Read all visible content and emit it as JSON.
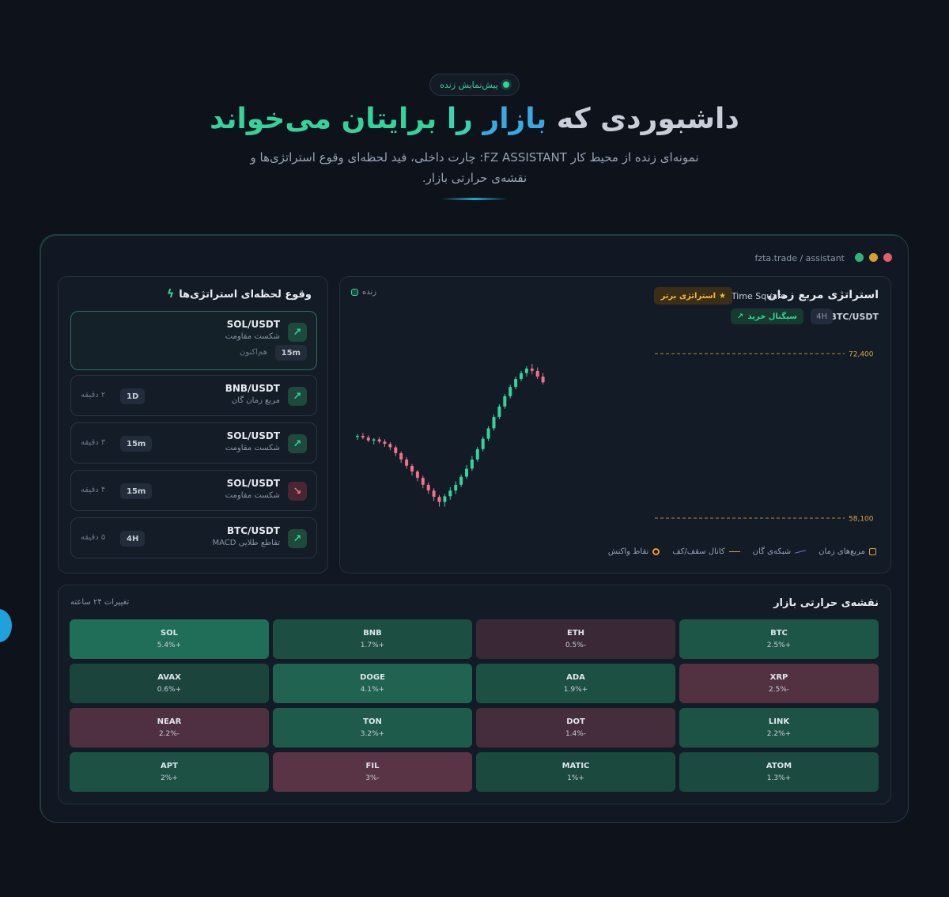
{
  "hero": {
    "badge": "پیش‌نمایش زنده",
    "title_part1": "داشبوردی که",
    "title_part2": "بازار",
    "title_part3": "را",
    "title_part4": "برایتان می‌خواند",
    "subtitle_line1": "نمونه‌ای زنده از محیط کار FZ ASSISTANT: چارت داخلی، فید لحظه‌ای وقوع استراتژی‌ها و",
    "subtitle_line2": "نقشه‌ی حرارتی بازار."
  },
  "window": {
    "url": "fzta.trade / assistant",
    "dot_colors": [
      "#e05e6e",
      "#d4a22b",
      "#2fb57a"
    ]
  },
  "feed": {
    "title": "وقوع لحظه‌ای استراتژی‌ها",
    "icon": "bolt-icon",
    "items": [
      {
        "pair": "SOL/USDT",
        "strategy": "شکست مقاومت",
        "tf": "15m",
        "time": "هم‌اکنون",
        "direction": "up"
      },
      {
        "pair": "BNB/USDT",
        "strategy": "مربع زمان گان",
        "tf": "1D",
        "time": "۲ دقیقه",
        "direction": "up"
      },
      {
        "pair": "SOL/USDT",
        "strategy": "شکست مقاومت",
        "tf": "15m",
        "time": "۳ دقیقه",
        "direction": "up"
      },
      {
        "pair": "SOL/USDT",
        "strategy": "شکست مقاومت",
        "tf": "15m",
        "time": "۴ دقیقه",
        "direction": "down"
      },
      {
        "pair": "BTC/USDT",
        "strategy": "تقاطع طلایی MACD",
        "tf": "4H",
        "time": "۵ دقیقه",
        "direction": "up"
      }
    ]
  },
  "chart_panel": {
    "title": "استراتژی مربع زمان",
    "brand": "Time Square",
    "badge": "استراتژی برتر",
    "pair": "BTC/USDT",
    "timeframe": "4H",
    "signal": "سیگنال خرید",
    "live": "زنده",
    "legend": [
      "مربع‌های زمان",
      "شبکه‌ی گان",
      "کانال سقف/کف",
      "نقاط واکنش"
    ]
  },
  "chart_data": {
    "type": "candlestick",
    "levels": [
      {
        "label": "72,400",
        "value": 72400,
        "color": "#d9a53a"
      },
      {
        "label": "58,100",
        "value": 58100,
        "color": "#d9a53a"
      }
    ],
    "candles": [
      [
        65150,
        65400,
        64900,
        65250
      ],
      [
        65250,
        65500,
        64950,
        65100
      ],
      [
        65100,
        65300,
        64700,
        64850
      ],
      [
        64850,
        65050,
        64500,
        64950
      ],
      [
        64950,
        65150,
        64600,
        64750
      ],
      [
        64750,
        64950,
        64300,
        64550
      ],
      [
        64550,
        64700,
        64000,
        64250
      ],
      [
        64250,
        64400,
        63500,
        63750
      ],
      [
        63750,
        63900,
        62900,
        63200
      ],
      [
        63200,
        63400,
        62400,
        62650
      ],
      [
        62650,
        62800,
        61800,
        62150
      ],
      [
        62150,
        62300,
        61300,
        61600
      ],
      [
        61600,
        61800,
        60700,
        61000
      ],
      [
        61000,
        61200,
        60200,
        60500
      ],
      [
        60500,
        60700,
        59600,
        59950
      ],
      [
        59950,
        60100,
        59100,
        59500
      ],
      [
        59500,
        60200,
        59100,
        60000
      ],
      [
        60000,
        60800,
        59700,
        60500
      ],
      [
        60500,
        61300,
        60200,
        61000
      ],
      [
        61000,
        61900,
        60800,
        61700
      ],
      [
        61700,
        62700,
        61500,
        62400
      ],
      [
        62400,
        63500,
        62200,
        63200
      ],
      [
        63200,
        64300,
        63000,
        64100
      ],
      [
        64100,
        65200,
        63900,
        65000
      ],
      [
        65000,
        66100,
        64800,
        65900
      ],
      [
        65900,
        67100,
        65700,
        66900
      ],
      [
        66900,
        68000,
        66700,
        67800
      ],
      [
        67800,
        68900,
        67600,
        68700
      ],
      [
        68700,
        69700,
        68500,
        69500
      ],
      [
        69500,
        70400,
        69300,
        70200
      ],
      [
        70200,
        70900,
        70000,
        70700
      ],
      [
        70700,
        71300,
        70400,
        71100
      ],
      [
        71100,
        71500,
        70600,
        70900
      ],
      [
        70900,
        71200,
        70200,
        70400
      ],
      [
        70400,
        70700,
        69700,
        69900
      ]
    ]
  },
  "heatmap": {
    "title": "نقشه‌ی حرارتی بازار",
    "subtitle": "تغییرات ۲۴ ساعته",
    "cells": [
      {
        "symbol": "BTC",
        "change": "2.5%+",
        "value": 2.5
      },
      {
        "symbol": "ETH",
        "change": "0.5%-",
        "value": -0.5
      },
      {
        "symbol": "BNB",
        "change": "1.7%+",
        "value": 1.7
      },
      {
        "symbol": "SOL",
        "change": "5.4%+",
        "value": 5.4
      },
      {
        "symbol": "XRP",
        "change": "2.5%-",
        "value": -2.5
      },
      {
        "symbol": "ADA",
        "change": "1.9%+",
        "value": 1.9
      },
      {
        "symbol": "DOGE",
        "change": "4.1%+",
        "value": 4.1
      },
      {
        "symbol": "AVAX",
        "change": "0.6%+",
        "value": 0.6
      },
      {
        "symbol": "LINK",
        "change": "2.2%+",
        "value": 2.2
      },
      {
        "symbol": "DOT",
        "change": "1.4%-",
        "value": -1.4
      },
      {
        "symbol": "TON",
        "change": "3.2%+",
        "value": 3.2
      },
      {
        "symbol": "NEAR",
        "change": "2.2%-",
        "value": -2.2
      },
      {
        "symbol": "ATOM",
        "change": "1.3%+",
        "value": 1.3
      },
      {
        "symbol": "MATIC",
        "change": "1%+",
        "value": 1
      },
      {
        "symbol": "FIL",
        "change": "3%-",
        "value": -3
      },
      {
        "symbol": "APT",
        "change": "2%+",
        "value": 2
      }
    ]
  }
}
